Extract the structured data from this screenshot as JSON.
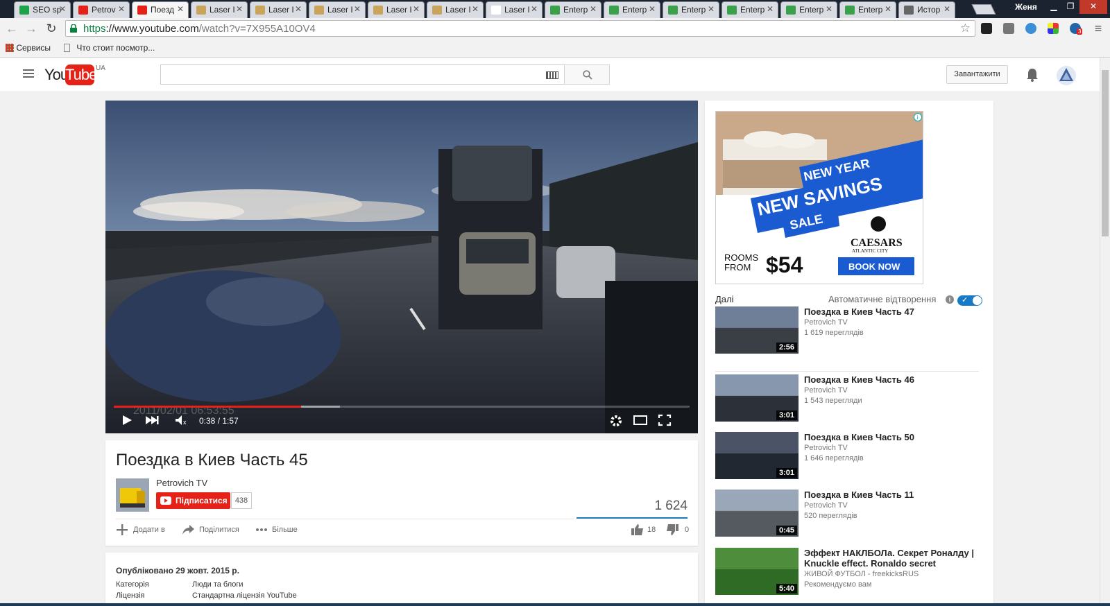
{
  "browser": {
    "tabs": [
      {
        "title": "SEO sp",
        "favicon_color": "#1fa34a",
        "active": false
      },
      {
        "title": "Petrov",
        "favicon_color": "#e62117",
        "active": false
      },
      {
        "title": "Поезд",
        "favicon_color": "#e62117",
        "active": true
      },
      {
        "title": "Laser I",
        "favicon_color": "#c9a45a",
        "active": false
      },
      {
        "title": "Laser I",
        "favicon_color": "#c9a45a",
        "active": false
      },
      {
        "title": "Laser I",
        "favicon_color": "#c9a45a",
        "active": false
      },
      {
        "title": "Laser I",
        "favicon_color": "#c9a45a",
        "active": false
      },
      {
        "title": "Laser I",
        "favicon_color": "#c9a45a",
        "active": false
      },
      {
        "title": "Laser I",
        "favicon_color": "#ffffff",
        "active": false
      },
      {
        "title": "Enterp",
        "favicon_color": "#3aa04a",
        "active": false
      },
      {
        "title": "Enterp",
        "favicon_color": "#3aa04a",
        "active": false
      },
      {
        "title": "Enterp",
        "favicon_color": "#3aa04a",
        "active": false
      },
      {
        "title": "Enterp",
        "favicon_color": "#3aa04a",
        "active": false
      },
      {
        "title": "Enterp",
        "favicon_color": "#3aa04a",
        "active": false
      },
      {
        "title": "Enterp",
        "favicon_color": "#3aa04a",
        "active": false
      },
      {
        "title": "Истор",
        "favicon_color": "#666666",
        "active": false
      }
    ],
    "profile_name": "Женя",
    "url": {
      "scheme": "https",
      "host": "://www.youtube.com",
      "path": "/watch?v=7X955A10OV4"
    },
    "bookmarks": [
      {
        "label": "Сервисы",
        "icon": "apps-grid-icon"
      },
      {
        "label": "Что стоит посмотр...",
        "icon": "page-icon"
      }
    ],
    "extension_badge": "3"
  },
  "youtube": {
    "logo_you": "You",
    "logo_tube": "Tube",
    "region": "UA",
    "upload_label": "Завантажити",
    "brand_red": "#e62117",
    "accent_blue": "#167ac6"
  },
  "player": {
    "time": "0:38 / 1:57",
    "played_fraction": 0.325,
    "loaded_fraction": 0.393,
    "overlay_timestamp": "2011/02/01  06:53:55"
  },
  "video": {
    "title": "Поездка в Киев Часть 45",
    "channel": "Petrovich TV",
    "subscribe_label": "Підписатися",
    "subscriber_count": "438",
    "views": "1 624",
    "add_to_label": "Додати в",
    "share_label": "Поділитися",
    "more_label": "Більше",
    "likes": "18",
    "dislikes": "0",
    "published": "Опубліковано 29 жовт. 2015 р.",
    "category_label": "Категорія",
    "category_value": "Люди та блоги",
    "license_label": "Ліцензія",
    "license_value": "Стандартна ліцензія YouTube"
  },
  "ad": {
    "line1": "NEW YEAR",
    "line2": "NEW SAVINGS",
    "line3": "SALE",
    "brand": "CAESARS",
    "brand_sub": "ATLANTIC CITY",
    "rooms": "ROOMS",
    "from": "FROM",
    "price": "$54",
    "cta": "BOOK NOW"
  },
  "sidebar": {
    "up_next_label": "Далі",
    "autoplay_label": "Автоматичне відтворення",
    "autoplay_on": true,
    "recommendations": [
      {
        "title": "Поездка в Киев Часть 47",
        "channel": "Petrovich TV",
        "views": "1 619 переглядів",
        "duration": "2:56"
      },
      {
        "title": "Поездка в Киев Часть 46",
        "channel": "Petrovich TV",
        "views": "1 543 перегляди",
        "duration": "3:01"
      },
      {
        "title": "Поездка в Киев Часть 50",
        "channel": "Petrovich TV",
        "views": "1 646 переглядів",
        "duration": "3:01"
      },
      {
        "title": "Поездка в Киев Часть 11",
        "channel": "Petrovich TV",
        "views": "520 переглядів",
        "duration": "0:45"
      },
      {
        "title": "Эффект НАКЛБОЛа. Секрет Роналду | Knuckle effect. Ronaldo secret",
        "channel": "ЖИВОЙ ФУТБОЛ - freekicksRUS",
        "views": "Рекомендуємо вам",
        "duration": "5:40"
      }
    ]
  }
}
